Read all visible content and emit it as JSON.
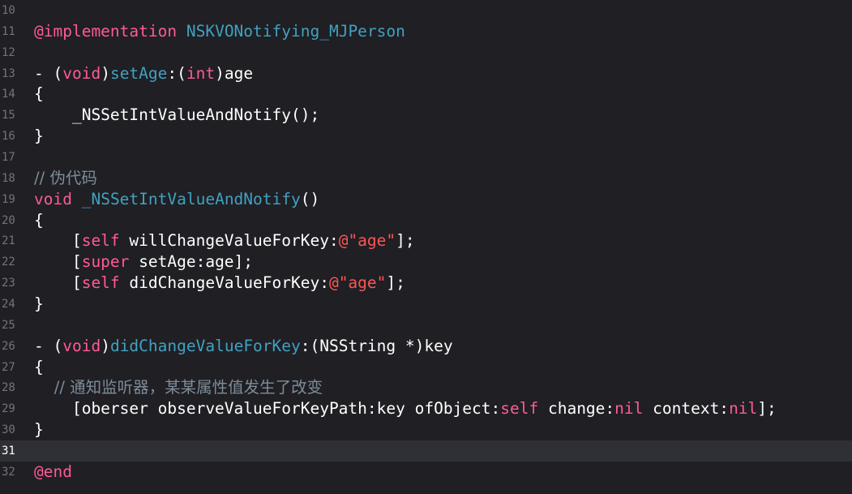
{
  "colors": {
    "background": "#1f1f24",
    "current_line": "#2f3036",
    "keyword": "#ff5a97",
    "type": "#41a1c0",
    "string": "#ff5555",
    "comment": "#7f8c98",
    "line_number": "#747478"
  },
  "lines": [
    {
      "num": "10",
      "tokens": []
    },
    {
      "num": "11",
      "tokens": [
        {
          "t": "@implementation",
          "c": "kw"
        },
        {
          "t": " ",
          "c": "plain"
        },
        {
          "t": "NSKVONotifying_MJPerson",
          "c": "type"
        }
      ]
    },
    {
      "num": "12",
      "tokens": []
    },
    {
      "num": "13",
      "tokens": [
        {
          "t": "- (",
          "c": "plain"
        },
        {
          "t": "void",
          "c": "kw"
        },
        {
          "t": ")",
          "c": "plain"
        },
        {
          "t": "setAge",
          "c": "type"
        },
        {
          "t": ":(",
          "c": "plain"
        },
        {
          "t": "int",
          "c": "kw"
        },
        {
          "t": ")age",
          "c": "plain"
        }
      ]
    },
    {
      "num": "14",
      "tokens": [
        {
          "t": "{",
          "c": "plain"
        }
      ]
    },
    {
      "num": "15",
      "tokens": [
        {
          "t": "    _NSSetIntValueAndNotify();",
          "c": "plain"
        }
      ]
    },
    {
      "num": "16",
      "tokens": [
        {
          "t": "}",
          "c": "plain"
        }
      ]
    },
    {
      "num": "17",
      "tokens": []
    },
    {
      "num": "18",
      "tokens": [
        {
          "t": "// 伪代码",
          "c": "cmt"
        }
      ]
    },
    {
      "num": "19",
      "tokens": [
        {
          "t": "void",
          "c": "kw"
        },
        {
          "t": " ",
          "c": "plain"
        },
        {
          "t": "_NSSetIntValueAndNotify",
          "c": "type"
        },
        {
          "t": "()",
          "c": "plain"
        }
      ]
    },
    {
      "num": "20",
      "tokens": [
        {
          "t": "{",
          "c": "plain"
        }
      ]
    },
    {
      "num": "21",
      "tokens": [
        {
          "t": "    [",
          "c": "plain"
        },
        {
          "t": "self",
          "c": "kw"
        },
        {
          "t": " willChangeValueForKey:",
          "c": "plain"
        },
        {
          "t": "@\"age\"",
          "c": "str"
        },
        {
          "t": "];",
          "c": "plain"
        }
      ]
    },
    {
      "num": "22",
      "tokens": [
        {
          "t": "    [",
          "c": "plain"
        },
        {
          "t": "super",
          "c": "kw"
        },
        {
          "t": " setAge:age];",
          "c": "plain"
        }
      ]
    },
    {
      "num": "23",
      "tokens": [
        {
          "t": "    [",
          "c": "plain"
        },
        {
          "t": "self",
          "c": "kw"
        },
        {
          "t": " didChangeValueForKey:",
          "c": "plain"
        },
        {
          "t": "@\"age\"",
          "c": "str"
        },
        {
          "t": "];",
          "c": "plain"
        }
      ]
    },
    {
      "num": "24",
      "tokens": [
        {
          "t": "}",
          "c": "plain"
        }
      ]
    },
    {
      "num": "25",
      "tokens": []
    },
    {
      "num": "26",
      "tokens": [
        {
          "t": "- (",
          "c": "plain"
        },
        {
          "t": "void",
          "c": "kw"
        },
        {
          "t": ")",
          "c": "plain"
        },
        {
          "t": "didChangeValueForKey",
          "c": "type"
        },
        {
          "t": ":(NSString *)key",
          "c": "plain"
        }
      ]
    },
    {
      "num": "27",
      "tokens": [
        {
          "t": "{",
          "c": "plain"
        }
      ]
    },
    {
      "num": "28",
      "tokens": [
        {
          "t": "    // 通知监听器，某某属性值发生了改变",
          "c": "cmt"
        }
      ]
    },
    {
      "num": "29",
      "tokens": [
        {
          "t": "    [oberser observeValueForKeyPath:key ofObject:",
          "c": "plain"
        },
        {
          "t": "self",
          "c": "kw"
        },
        {
          "t": " change:",
          "c": "plain"
        },
        {
          "t": "nil",
          "c": "kw"
        },
        {
          "t": " context:",
          "c": "plain"
        },
        {
          "t": "nil",
          "c": "kw"
        },
        {
          "t": "];",
          "c": "plain"
        }
      ]
    },
    {
      "num": "30",
      "tokens": [
        {
          "t": "}",
          "c": "plain"
        }
      ]
    },
    {
      "num": "31",
      "tokens": [],
      "current": true
    },
    {
      "num": "32",
      "tokens": [
        {
          "t": "@end",
          "c": "kw"
        }
      ]
    }
  ]
}
